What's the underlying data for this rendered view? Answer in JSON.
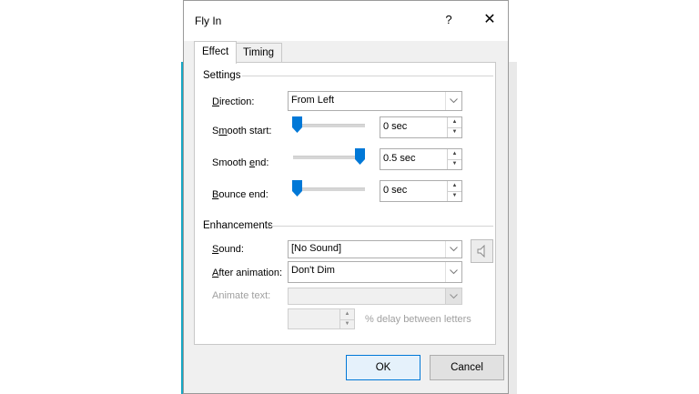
{
  "dialog": {
    "title": "Fly In",
    "help_glyph": "?",
    "close_glyph": "✕"
  },
  "tabs": [
    {
      "label": "Effect",
      "active": true
    },
    {
      "label": "Timing",
      "active": false
    }
  ],
  "settings": {
    "group_label": "Settings",
    "direction": {
      "label": "Direction:",
      "value": "From Left"
    },
    "smooth_start": {
      "label": "Smooth start:",
      "value": "0 sec",
      "slider_fraction": 0.0
    },
    "smooth_end": {
      "label": "Smooth end:",
      "value": "0.5 sec",
      "slider_fraction": 1.0
    },
    "bounce_end": {
      "label": "Bounce end:",
      "value": "0 sec",
      "slider_fraction": 0.0
    }
  },
  "enhancements": {
    "group_label": "Enhancements",
    "sound": {
      "label": "Sound:",
      "value": "[No Sound]"
    },
    "after_animation": {
      "label": "After animation:",
      "value": "Don't Dim"
    },
    "animate_text": {
      "label": "Animate text:",
      "value": ""
    },
    "delay": {
      "value": "",
      "suffix": "% delay between letters"
    }
  },
  "buttons": {
    "ok": "OK",
    "cancel": "Cancel"
  },
  "colors": {
    "accent": "#0078d7",
    "background_app": "#17a7c4"
  },
  "icons": {
    "sound": "speaker-icon",
    "dropdown": "chevron-down-icon",
    "spin_up": "spin-up-icon",
    "spin_down": "spin-down-icon"
  }
}
